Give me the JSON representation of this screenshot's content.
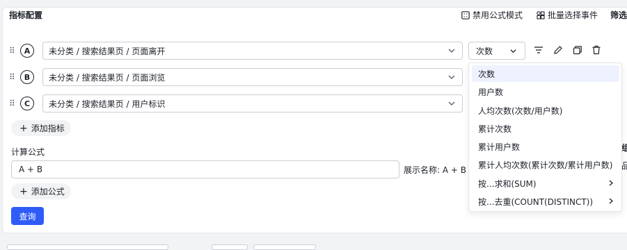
{
  "panel": {
    "title": "指标配置",
    "toolbar": {
      "disable_formula": "禁用公式模式",
      "batch_select": "批量选择事件"
    },
    "right_label": "筛选"
  },
  "indicators": [
    {
      "letter": "A",
      "value": "未分类 / 搜索结果页 / 页面离开"
    },
    {
      "letter": "B",
      "value": "未分类 / 搜索结果页 / 页面浏览"
    },
    {
      "letter": "C",
      "value": "未分类 / 搜索结果页 / 用户标识"
    }
  ],
  "metric_select": {
    "value": "次数"
  },
  "add_indicator": "添加指标",
  "formula": {
    "label": "计算公式",
    "value": "A + B",
    "display_name_label": "展示名称:",
    "display_name_value": "A + B"
  },
  "add_formula": "添加公式",
  "query_button": "查询",
  "dropdown": {
    "options": [
      {
        "label": "次数",
        "active": true
      },
      {
        "label": "用户数"
      },
      {
        "label": "人均次数(次数/用户数)"
      },
      {
        "label": "累计次数"
      },
      {
        "label": "累计用户数"
      },
      {
        "label": "累计人均次数(累计次数/累计用户数)"
      },
      {
        "label": "按...求和(SUM)",
        "submenu": true
      },
      {
        "label": "按...去重(COUNT(DISTINCT))",
        "submenu": true
      }
    ]
  },
  "side_peek": {
    "a": "组",
    "b": "品"
  },
  "colors": {
    "primary": "#2f5cf6",
    "border": "#c9cdd4",
    "active_bg": "#eef2ff"
  }
}
